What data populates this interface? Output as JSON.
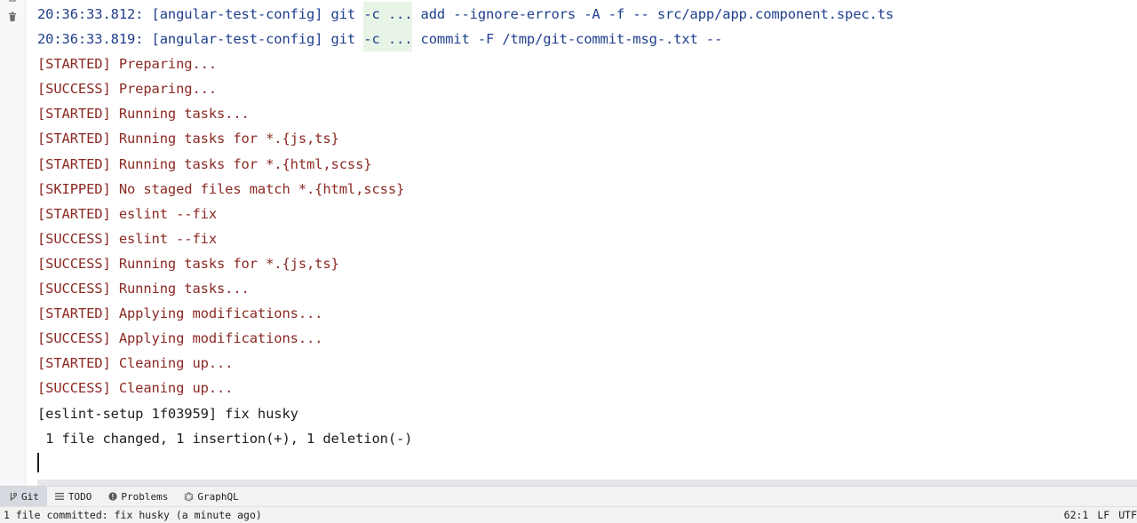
{
  "console": {
    "lines": [
      {
        "type": "git",
        "pre": "20:36:33.812: [angular-test-config] git ",
        "flag": "-c ...",
        "post": " add --ignore-errors -A -f -- src/app/app.component.spec.ts"
      },
      {
        "type": "git",
        "pre": "20:36:33.819: [angular-test-config] git ",
        "flag": "-c ...",
        "post": " commit -F /tmp/git-commit-msg-.txt --"
      },
      {
        "type": "lint",
        "text": "[STARTED] Preparing..."
      },
      {
        "type": "lint",
        "text": "[SUCCESS] Preparing..."
      },
      {
        "type": "lint",
        "text": "[STARTED] Running tasks..."
      },
      {
        "type": "lint",
        "text": "[STARTED] Running tasks for *.{js,ts}"
      },
      {
        "type": "lint",
        "text": "[STARTED] Running tasks for *.{html,scss}"
      },
      {
        "type": "lint",
        "text": "[SKIPPED] No staged files match *.{html,scss}"
      },
      {
        "type": "lint",
        "text": "[STARTED] eslint --fix"
      },
      {
        "type": "lint",
        "text": "[SUCCESS] eslint --fix"
      },
      {
        "type": "lint",
        "text": "[SUCCESS] Running tasks for *.{js,ts}"
      },
      {
        "type": "lint",
        "text": "[SUCCESS] Running tasks..."
      },
      {
        "type": "lint",
        "text": "[STARTED] Applying modifications..."
      },
      {
        "type": "lint",
        "text": "[SUCCESS] Applying modifications..."
      },
      {
        "type": "lint",
        "text": "[STARTED] Cleaning up..."
      },
      {
        "type": "lint",
        "text": "[SUCCESS] Cleaning up..."
      },
      {
        "type": "plain",
        "text": "[eslint-setup 1f03959] fix husky"
      },
      {
        "type": "plain",
        "text": " 1 file changed, 1 insertion(+), 1 deletion(-)"
      }
    ]
  },
  "gutter": {
    "icons": [
      "pin-icon",
      "trash-icon"
    ]
  },
  "toolwindows": {
    "tabs": [
      {
        "id": "git",
        "label": "Git",
        "icon": "branch-icon",
        "active": true
      },
      {
        "id": "todo",
        "label": "TODO",
        "icon": "list-icon",
        "active": false
      },
      {
        "id": "problems",
        "label": "Problems",
        "icon": "warning-circle-icon",
        "active": false
      },
      {
        "id": "graphql",
        "label": "GraphQL",
        "icon": "graphql-icon",
        "active": false
      }
    ]
  },
  "statusbar": {
    "message": "1 file committed: fix husky (a minute ago)",
    "position": "62:1",
    "line_ending": "LF",
    "encoding": "UTF"
  },
  "colors": {
    "git_text": "#1f3f8c",
    "lint_text": "#8b2a24",
    "plain_text": "#1e1e1e",
    "flag_highlight": "#e8f4e6"
  }
}
